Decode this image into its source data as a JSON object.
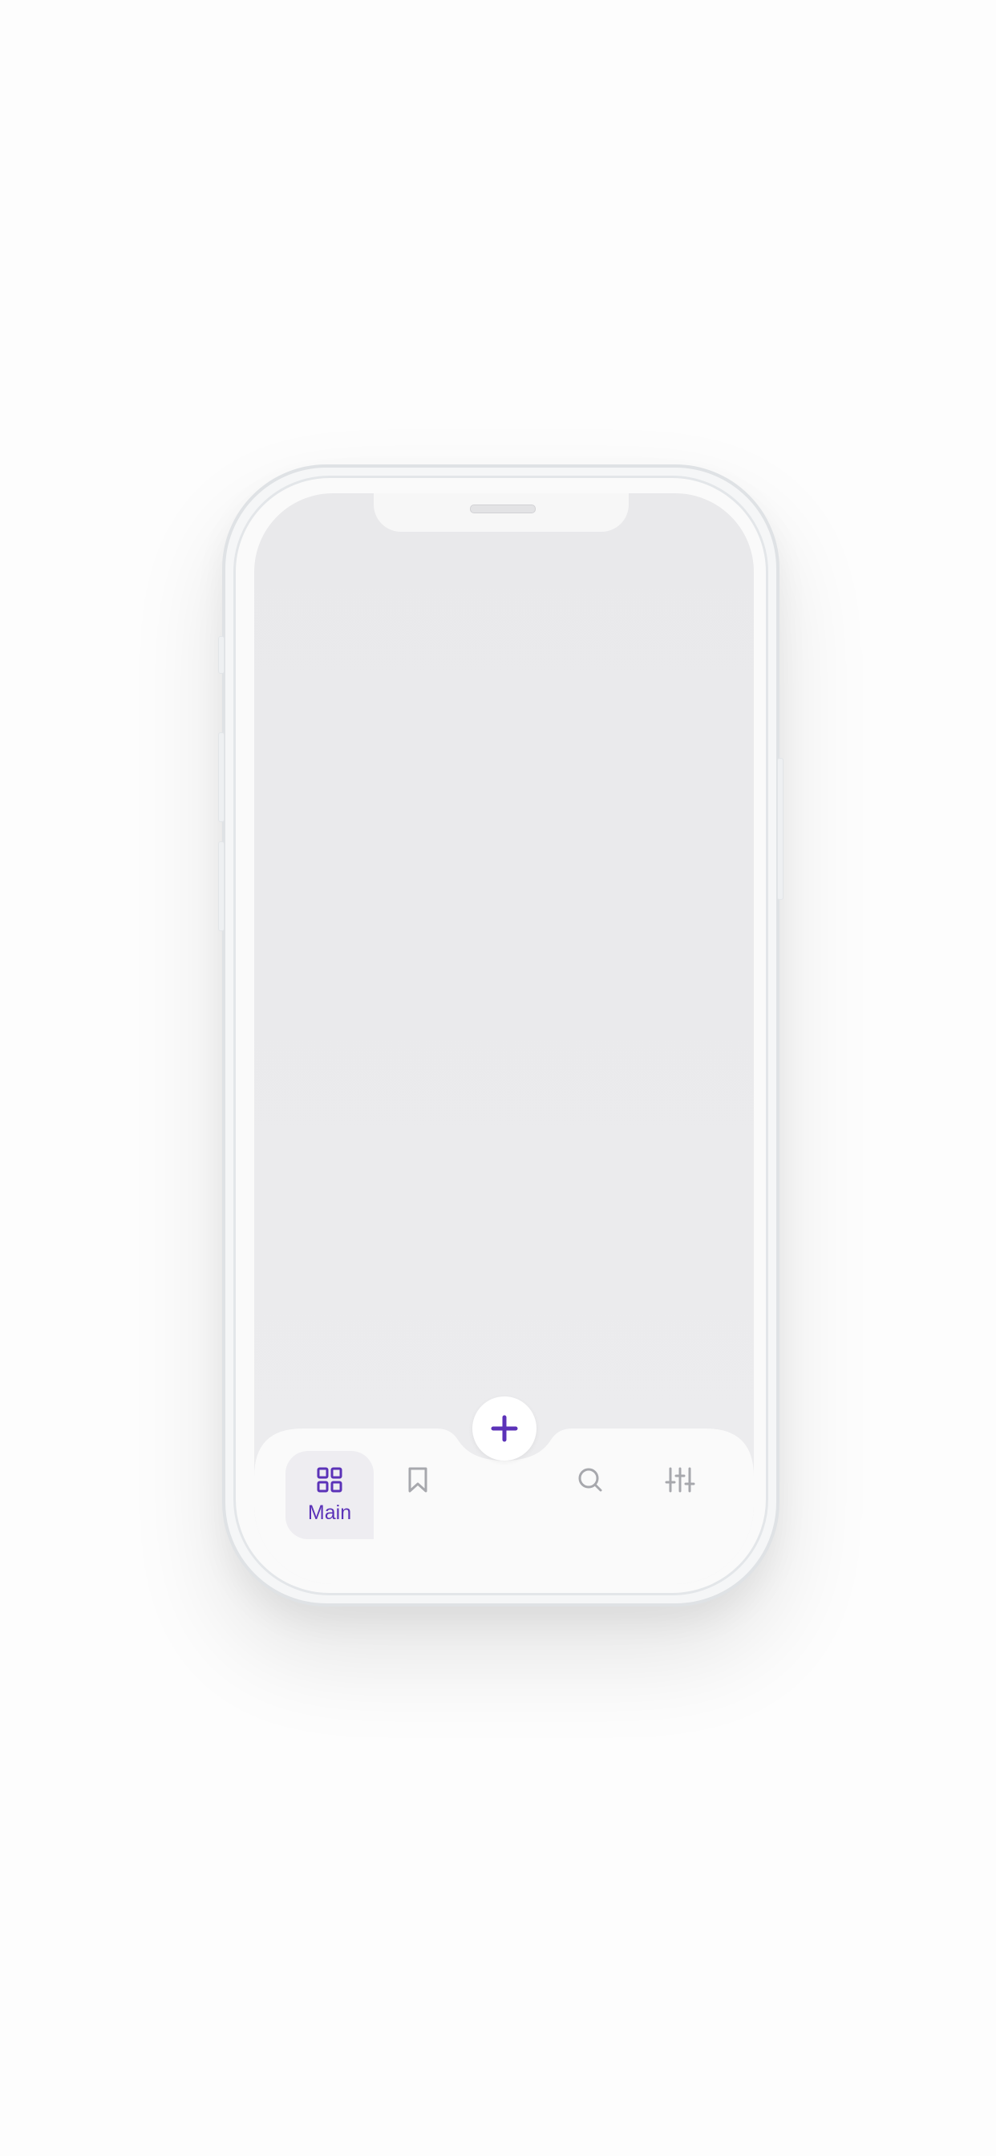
{
  "tabbar": {
    "tabs": [
      {
        "id": "main",
        "label": "Main",
        "icon": "grid-icon",
        "active": true
      },
      {
        "id": "saved",
        "label": "",
        "icon": "bookmark-icon",
        "active": false
      },
      {
        "id": "search",
        "label": "",
        "icon": "search-icon",
        "active": false
      },
      {
        "id": "filters",
        "label": "",
        "icon": "sliders-icon",
        "active": false
      }
    ],
    "fab_icon": "plus-icon"
  },
  "colors": {
    "accent": "#5b32b8",
    "inactive_icon": "#a7a8ad",
    "screen_bg": "#eaeaec",
    "bar_bg": "#fafafa"
  }
}
